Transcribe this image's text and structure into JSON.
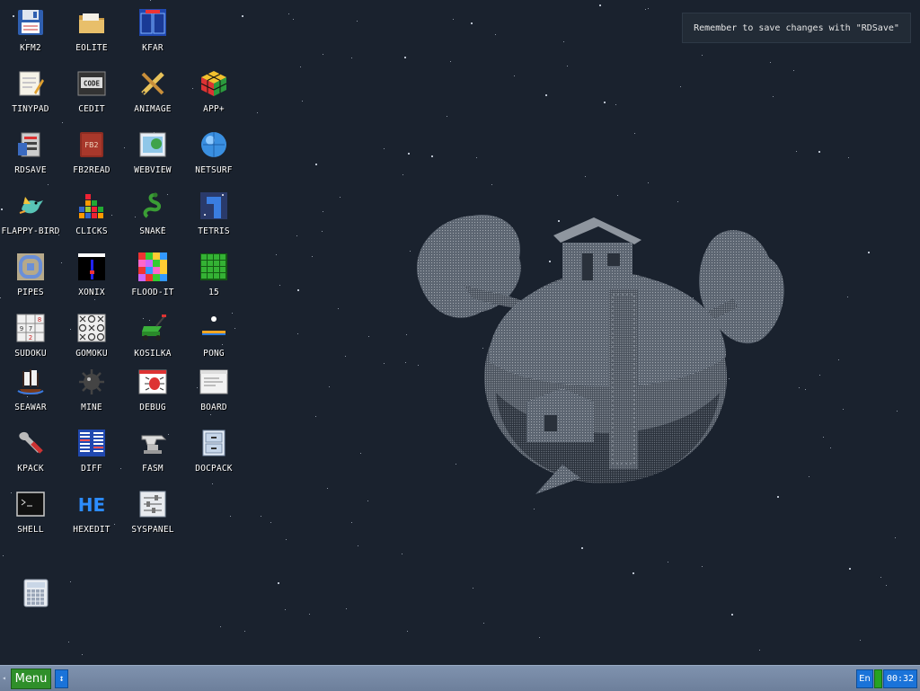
{
  "notification": {
    "text": "Remember to save changes with \"RDSave\""
  },
  "desktop": {
    "icons": [
      {
        "label": "KFM2",
        "icon": "floppy-disk-icon"
      },
      {
        "label": "EOLITE",
        "icon": "folder-icon"
      },
      {
        "label": "KFAR",
        "icon": "dual-panel-file-manager-icon"
      },
      {
        "label": "TINYPAD",
        "icon": "notepad-icon"
      },
      {
        "label": "CEDIT",
        "icon": "code-editor-icon"
      },
      {
        "label": "ANIMAGE",
        "icon": "pencil-ruler-icon"
      },
      {
        "label": "APP+",
        "icon": "rubiks-cube-icon"
      },
      {
        "label": "RDSAVE",
        "icon": "save-ramdisk-icon"
      },
      {
        "label": "FB2READ",
        "icon": "book-fb2-icon"
      },
      {
        "label": "WEBVIEW",
        "icon": "web-page-icon"
      },
      {
        "label": "NETSURF",
        "icon": "globe-icon"
      },
      {
        "label": "FLAPPY-BIRD",
        "icon": "bird-icon"
      },
      {
        "label": "CLICKS",
        "icon": "colored-blocks-icon"
      },
      {
        "label": "SNAKE",
        "icon": "snake-icon"
      },
      {
        "label": "TETRIS",
        "icon": "tetris-icon"
      },
      {
        "label": "PIPES",
        "icon": "pipes-icon"
      },
      {
        "label": "XONIX",
        "icon": "xonix-icon"
      },
      {
        "label": "FLOOD-IT",
        "icon": "flood-it-icon"
      },
      {
        "label": "15",
        "icon": "fifteen-puzzle-icon"
      },
      {
        "label": "SUDOKU",
        "icon": "sudoku-icon"
      },
      {
        "label": "GOMOKU",
        "icon": "gomoku-icon"
      },
      {
        "label": "KOSILKA",
        "icon": "lawn-mower-icon"
      },
      {
        "label": "PONG",
        "icon": "pong-icon"
      },
      {
        "label": "SEAWAR",
        "icon": "sailing-ship-icon"
      },
      {
        "label": "MINE",
        "icon": "sea-mine-icon"
      },
      {
        "label": "DEBUG",
        "icon": "bug-icon"
      },
      {
        "label": "BOARD",
        "icon": "board-window-icon"
      },
      {
        "label": "KPACK",
        "icon": "wrench-icon"
      },
      {
        "label": "DIFF",
        "icon": "diff-icon"
      },
      {
        "label": "FASM",
        "icon": "anvil-icon"
      },
      {
        "label": "DOCPACK",
        "icon": "cabinet-icon"
      },
      {
        "label": "SHELL",
        "icon": "terminal-icon"
      },
      {
        "label": "HEXEDIT",
        "icon": "hex-editor-icon"
      },
      {
        "label": "SYSPANEL",
        "icon": "sliders-panel-icon"
      },
      {
        "label": "",
        "icon": "calculator-icon"
      }
    ]
  },
  "wallpaper": {
    "subject": "planet-with-treehouse-icon"
  },
  "taskbar": {
    "menu_label": "Menu",
    "swap_icon": "swap-arrows-icon",
    "language": "En",
    "clock": "00:32",
    "colors": {
      "bar": "#7689a6",
      "menu": "#2f8f2a",
      "tray": "#1a73d9"
    }
  }
}
